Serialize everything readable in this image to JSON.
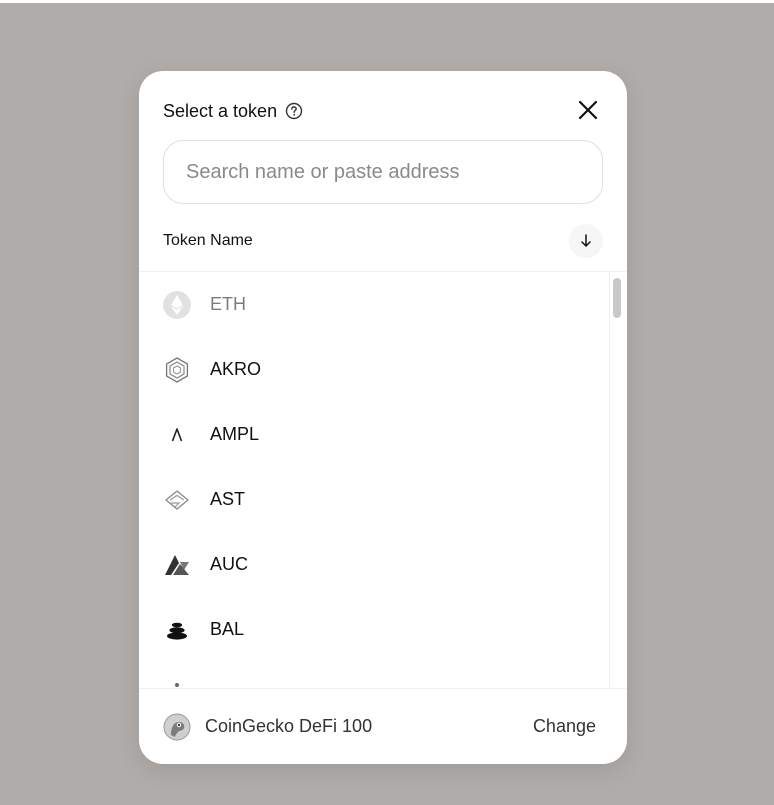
{
  "modal": {
    "title": "Select a token",
    "help_icon": "question-circle-icon",
    "close_icon": "close-icon"
  },
  "search": {
    "placeholder": "Search name or paste address",
    "value": ""
  },
  "list_header": {
    "label": "Token Name",
    "sort_icon": "arrow-down-icon"
  },
  "tokens": [
    {
      "symbol": "ETH",
      "icon": "eth-icon",
      "disabled": true
    },
    {
      "symbol": "AKRO",
      "icon": "akro-icon",
      "disabled": false
    },
    {
      "symbol": "AMPL",
      "icon": "ampl-icon",
      "disabled": false
    },
    {
      "symbol": "AST",
      "icon": "ast-icon",
      "disabled": false
    },
    {
      "symbol": "AUC",
      "icon": "auc-icon",
      "disabled": false
    },
    {
      "symbol": "BAL",
      "icon": "bal-icon",
      "disabled": false
    }
  ],
  "footer": {
    "list_name": "CoinGecko DeFi 100",
    "list_icon": "coingecko-icon",
    "change_label": "Change"
  },
  "colors": {
    "backdrop": "#b0aca9",
    "surface": "#ffffff",
    "text": "#111111",
    "muted": "#8a8a8a"
  }
}
